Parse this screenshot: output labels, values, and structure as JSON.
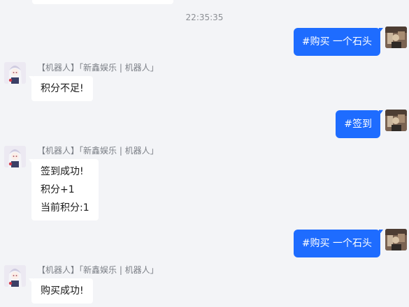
{
  "timestamp": "22:35:35",
  "messages": [
    {
      "side": "out",
      "lines": [
        "#购买 一个石头"
      ]
    },
    {
      "side": "in",
      "sender": "【机器人】「新鑫娱乐 | 机器人」",
      "lines": [
        "积分不足!"
      ]
    },
    {
      "side": "out",
      "lines": [
        "#签到"
      ]
    },
    {
      "side": "in",
      "sender": "【机器人】「新鑫娱乐 | 机器人」",
      "lines": [
        "签到成功!",
        "积分+1",
        "当前积分:1"
      ]
    },
    {
      "side": "out",
      "lines": [
        "#购买 一个石头"
      ]
    },
    {
      "side": "in",
      "sender": "【机器人】「新鑫娱乐 | 机器人」",
      "lines": [
        "购买成功!"
      ]
    }
  ],
  "colors": {
    "background": "#f3f4f7",
    "outgoing_bubble": "#1e6cff",
    "incoming_bubble": "#ffffff",
    "sender_text": "#7b7f86"
  }
}
